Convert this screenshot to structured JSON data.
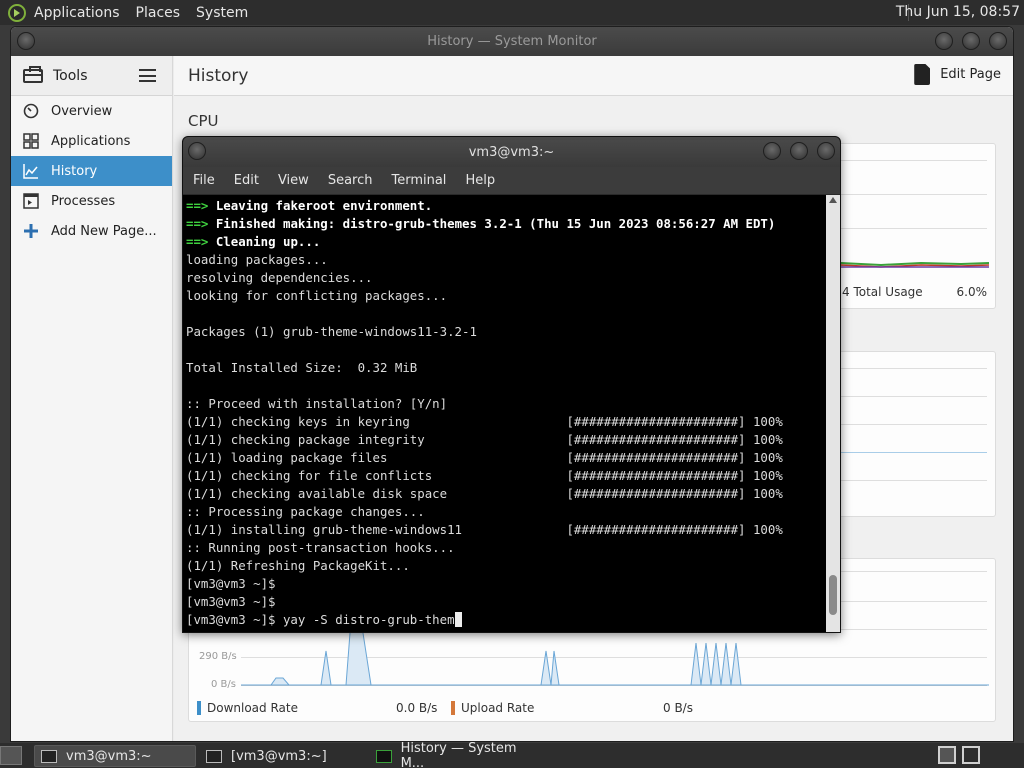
{
  "top_panel": {
    "menus": [
      "Applications",
      "Places",
      "System"
    ],
    "clock": "Thu Jun 15, 08:57"
  },
  "system_monitor": {
    "window_title": "History — System Monitor",
    "sidebar": {
      "header": "Tools",
      "items": [
        {
          "label": "Overview",
          "icon": "overview-icon"
        },
        {
          "label": "Applications",
          "icon": "applications-grid-icon"
        },
        {
          "label": "History",
          "icon": "history-chart-icon",
          "active": true
        },
        {
          "label": "Processes",
          "icon": "processes-icon"
        },
        {
          "label": "Add New Page...",
          "icon": "plus-icon"
        }
      ]
    },
    "page_title": "History",
    "edit_page": "Edit Page",
    "cpu_section": {
      "title": "CPU",
      "legend_label": "4 Total Usage",
      "legend_value": "6.0%"
    },
    "network_section": {
      "y_ticks": [
        "290 B/s",
        "0 B/s"
      ],
      "download_label": "Download Rate",
      "download_value": "0.0 B/s",
      "upload_label": "Upload Rate",
      "upload_value": "0 B/s",
      "download_color": "#3d8fc9",
      "upload_color": "#d4783a"
    }
  },
  "terminal": {
    "window_title": "vm3@vm3:~",
    "menus": [
      "File",
      "Edit",
      "View",
      "Search",
      "Terminal",
      "Help"
    ],
    "lines": [
      {
        "arrow": "==>",
        "bold": " Leaving fakeroot environment."
      },
      {
        "arrow": "==>",
        "bold": " Finished making: distro-grub-themes 3.2-1 (Thu 15 Jun 2023 08:56:27 AM EDT)"
      },
      {
        "arrow": "==>",
        "bold": " Cleaning up..."
      },
      {
        "text": "loading packages..."
      },
      {
        "text": "resolving dependencies..."
      },
      {
        "text": "looking for conflicting packages..."
      },
      {
        "text": ""
      },
      {
        "text": "Packages (1) grub-theme-windows11-3.2-1"
      },
      {
        "text": ""
      },
      {
        "text": "Total Installed Size:  0.32 MiB"
      },
      {
        "text": ""
      },
      {
        "text": ":: Proceed with installation? [Y/n]"
      },
      {
        "text": "(1/1) checking keys in keyring                     [######################] 100%"
      },
      {
        "text": "(1/1) checking package integrity                   [######################] 100%"
      },
      {
        "text": "(1/1) loading package files                        [######################] 100%"
      },
      {
        "text": "(1/1) checking for file conflicts                  [######################] 100%"
      },
      {
        "text": "(1/1) checking available disk space                [######################] 100%"
      },
      {
        "text": ":: Processing package changes..."
      },
      {
        "text": "(1/1) installing grub-theme-windows11              [######################] 100%"
      },
      {
        "text": ":: Running post-transaction hooks..."
      },
      {
        "text": "(1/1) Refreshing PackageKit..."
      },
      {
        "text": "[vm3@vm3 ~]$"
      },
      {
        "text": "[vm3@vm3 ~]$"
      },
      {
        "text": "[vm3@vm3 ~]$ yay -S distro-grub-them",
        "cursor": true
      }
    ]
  },
  "taskbar": {
    "tasks": [
      {
        "label": "vm3@vm3:~",
        "active": true
      },
      {
        "label": "[vm3@vm3:~]",
        "active": false
      },
      {
        "label": "History — System M...",
        "active": false
      }
    ]
  }
}
